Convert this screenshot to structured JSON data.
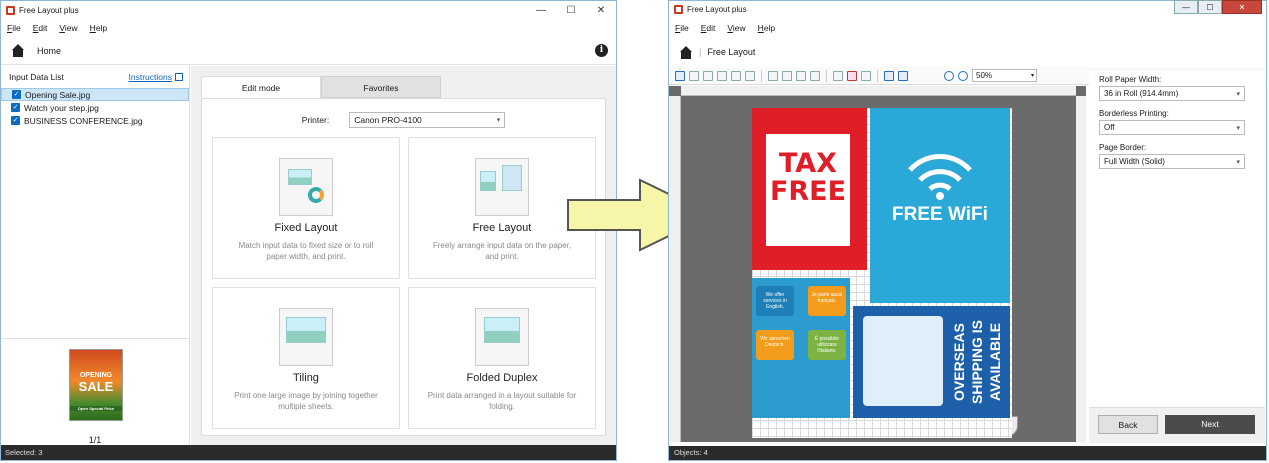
{
  "left_window": {
    "title": "Free Layout plus",
    "window_controls": [
      "—",
      "☐",
      "✕"
    ],
    "menu": [
      "File",
      "Edit",
      "View",
      "Help"
    ],
    "home_label": "Home",
    "input_list": {
      "title": "Input Data List",
      "instructions_link": "Instructions",
      "files": [
        {
          "name": "Opening Sale.jpg",
          "checked": true,
          "selected": true
        },
        {
          "name": "Watch your step.jpg",
          "checked": true,
          "selected": false
        },
        {
          "name": "BUSINESS CONFERENCE.jpg",
          "checked": true,
          "selected": false
        }
      ],
      "thumb_text": {
        "line1": "OPENING",
        "line2": "SALE",
        "line3": "Open Special Price"
      },
      "pager": "1/1"
    },
    "tabs": [
      "Edit mode",
      "Favorites"
    ],
    "printer_label": "Printer:",
    "printer_value": "Canon PRO-4100",
    "cards": [
      {
        "title": "Fixed Layout",
        "desc": "Match input data to fixed size or to roll paper width, and print."
      },
      {
        "title": "Free Layout",
        "desc": "Freely arrange input data on the paper, and print."
      },
      {
        "title": "Tiling",
        "desc": "Print one large image by joining together multiple sheets."
      },
      {
        "title": "Folded Duplex",
        "desc": "Print data arranged in a layout suitable for folding."
      }
    ],
    "status": "Selected: 3"
  },
  "right_window": {
    "title": "Free Layout plus",
    "window_controls": [
      "—",
      "☐",
      "✕"
    ],
    "menu": [
      "File",
      "Edit",
      "View",
      "Help"
    ],
    "breadcrumb": "Free Layout",
    "zoom": "50%",
    "posters": {
      "tax_l1": "TAX",
      "tax_l2": "FREE",
      "wifi": "FREE WiFi",
      "ship": "OVERSEAS SHIPPING IS AVAILABLE",
      "bubbles": [
        "We offer services in English.",
        "Je parle aussi français.",
        "Wir sprechen Deutsch.",
        "È possibile utilizzare l'italiano."
      ]
    },
    "settings": {
      "roll_label": "Roll Paper Width:",
      "roll_value": "36 in Roll (914.4mm)",
      "borderless_label": "Borderless Printing:",
      "borderless_value": "Off",
      "border_label": "Page Border:",
      "border_value": "Full Width (Solid)"
    },
    "back_label": "Back",
    "next_label": "Next",
    "status": "Objects: 4"
  },
  "colors": {
    "accent": "#0a6cc2",
    "arrow_fill": "#f7f5a8",
    "tax_red": "#e01e28",
    "wifi_blue": "#2aa8d8",
    "ship_blue": "#1d5fa8"
  }
}
